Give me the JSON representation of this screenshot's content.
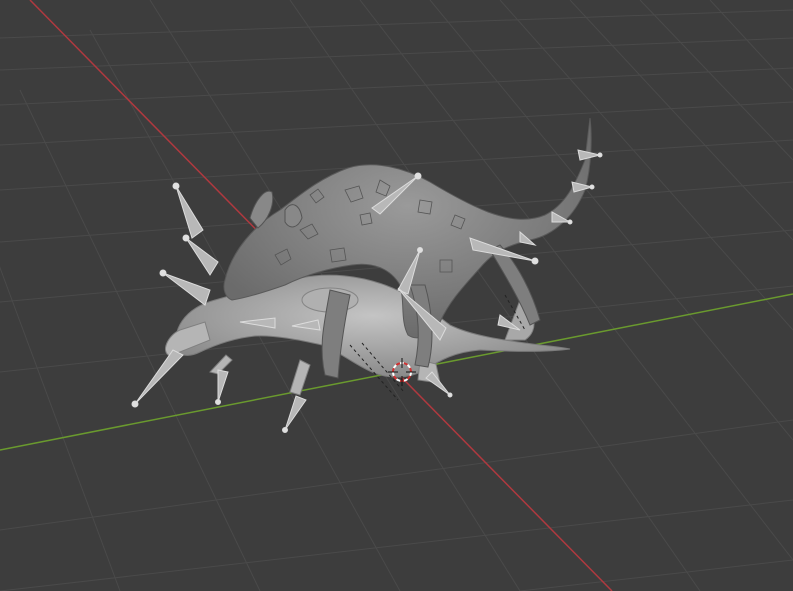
{
  "viewport": {
    "background_color": "#3d3d3d",
    "grid_color": "#4a4a4a",
    "x_axis_color": "#b0393f",
    "y_axis_color": "#6a9a2e",
    "mesh_color": "#8a8a8a",
    "armature_color": "#b8b8b8",
    "cursor_color": "#ffffff",
    "cursor_accent_color": "#d03030",
    "show_grid": true,
    "show_axes": true,
    "shading": "solid",
    "objects": [
      {
        "kind": "mesh",
        "icon": "creature-mesh"
      },
      {
        "kind": "armature",
        "icon": "bone-icon"
      }
    ],
    "overlays": [
      "3d-cursor",
      "floor-grid",
      "x-axis-line",
      "y-axis-line"
    ]
  }
}
